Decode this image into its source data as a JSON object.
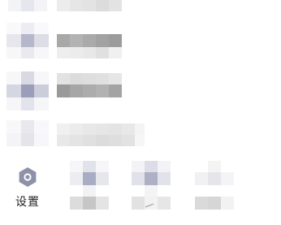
{
  "settings": {
    "label": "设置",
    "icon": "hexagon-gear-icon"
  },
  "colors": {
    "icon_fill": "#8d91a9",
    "label_text": "#222222",
    "background": "#ffffff"
  }
}
